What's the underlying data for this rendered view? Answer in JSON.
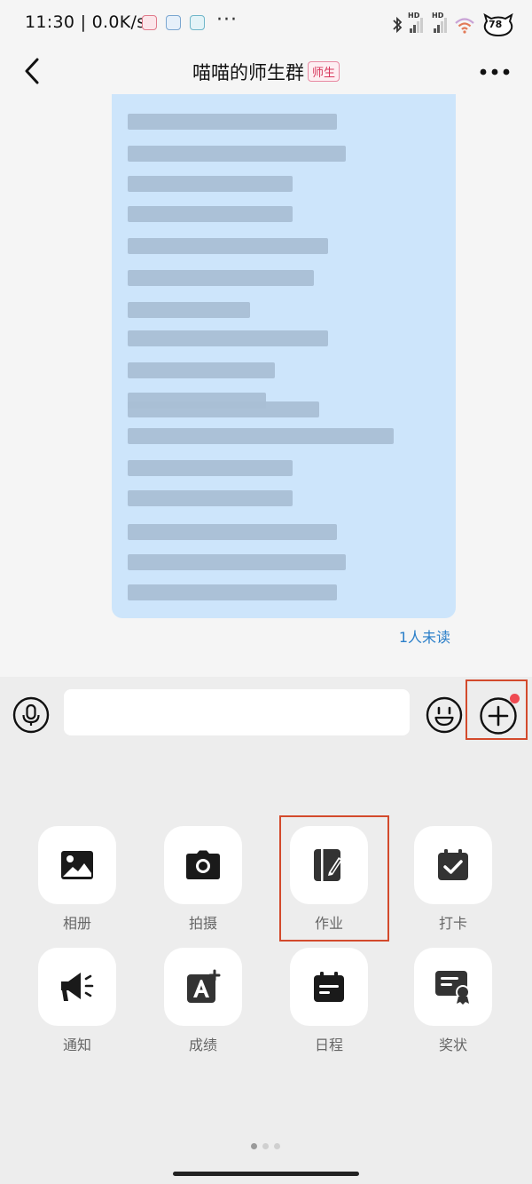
{
  "status_bar": {
    "time_speed": "11:30 | 0.0K/s",
    "dots": "···",
    "signal_label_1": "HD",
    "signal_label_2": "HD",
    "battery": "78"
  },
  "header": {
    "title": "喵喵的师生群",
    "badge": "师生"
  },
  "chat": {
    "unread_status": "1人未读"
  },
  "input": {
    "value": "",
    "placeholder": ""
  },
  "tools": [
    {
      "label": "相册",
      "icon": "photo-album-icon"
    },
    {
      "label": "拍摄",
      "icon": "camera-icon"
    },
    {
      "label": "作业",
      "icon": "homework-icon"
    },
    {
      "label": "打卡",
      "icon": "check-in-icon"
    },
    {
      "label": "通知",
      "icon": "megaphone-icon"
    },
    {
      "label": "成绩",
      "icon": "grade-icon"
    },
    {
      "label": "日程",
      "icon": "schedule-icon"
    },
    {
      "label": "奖状",
      "icon": "certificate-icon"
    }
  ],
  "colors": {
    "bubble": "#cde5fb",
    "accent_link": "#2b7fc9",
    "badge": "#d8365c",
    "highlight": "#d34a2c",
    "notify_dot": "#ef4a52"
  }
}
